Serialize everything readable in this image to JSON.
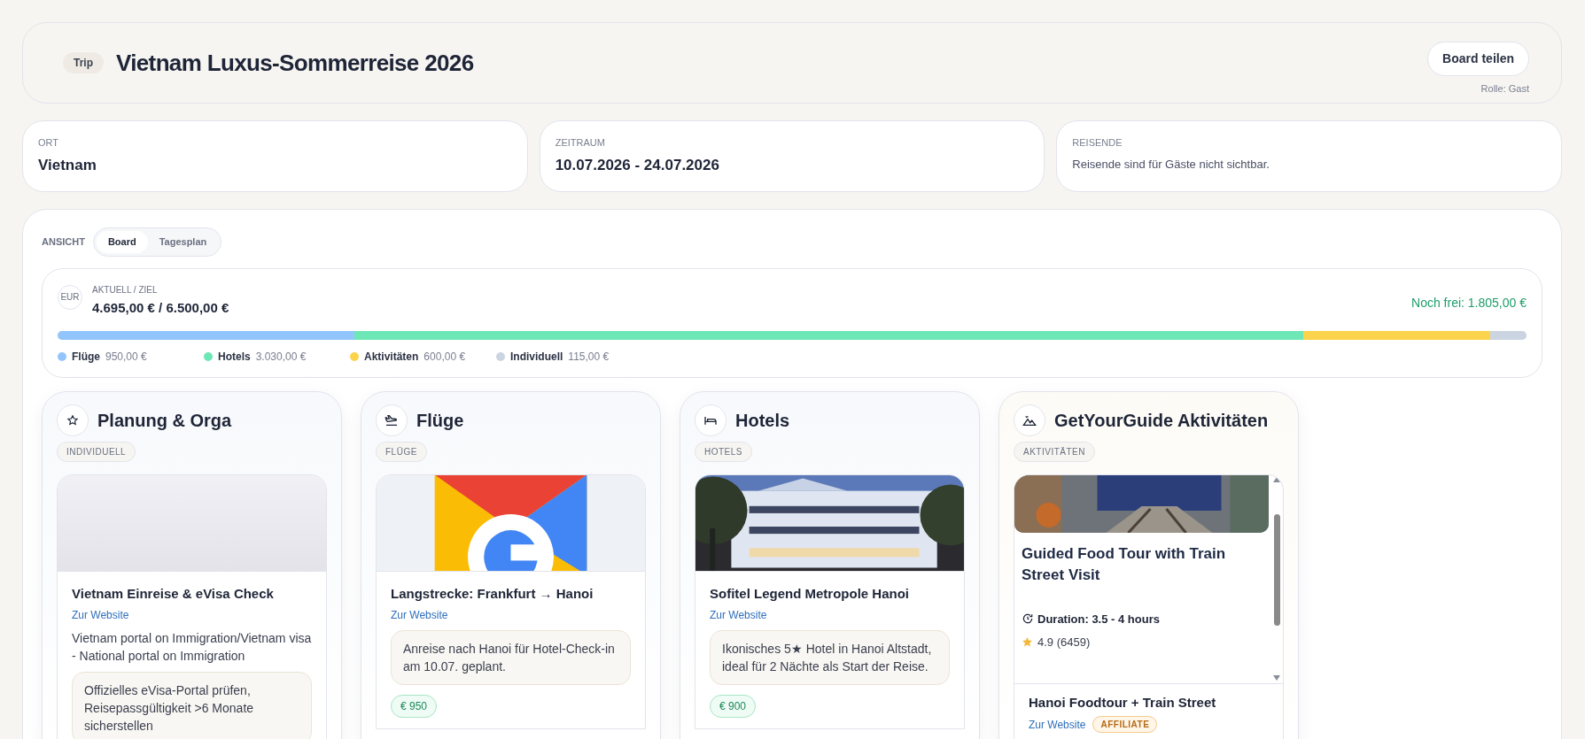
{
  "header": {
    "badge": "Trip",
    "title": "Vietnam Luxus-Sommerreise 2026",
    "share_button": "Board teilen",
    "role": "Rolle: Gast"
  },
  "info_cards": [
    {
      "label": "ORT",
      "value": "Vietnam",
      "kind": "value"
    },
    {
      "label": "ZEITRAUM",
      "value": "10.07.2026 - 24.07.2026",
      "kind": "value"
    },
    {
      "label": "REISENDE",
      "value": "Reisende sind für Gäste nicht sichtbar.",
      "kind": "note"
    }
  ],
  "view": {
    "label": "ANSICHT",
    "tabs": [
      {
        "label": "Board",
        "selected": true
      },
      {
        "label": "Tagesplan",
        "selected": false
      }
    ]
  },
  "budget": {
    "currency": "EUR",
    "caption": "AKTUELL / ZIEL",
    "amount": "4.695,00 € / 6.500,00 €",
    "remaining": "Noch frei: 1.805,00 €",
    "segments": [
      {
        "name": "Flüge",
        "value": "950,00 €",
        "color": "#93c5fd"
      },
      {
        "name": "Hotels",
        "value": "3.030,00 €",
        "color": "#6ee7b7"
      },
      {
        "name": "Aktivitäten",
        "value": "600,00 €",
        "color": "#fcd34d"
      },
      {
        "name": "Individuell",
        "value": "115,00 €",
        "color": "#cbd5e1"
      }
    ]
  },
  "columns": [
    {
      "title": "Planung & Orga",
      "tag": "INDIVIDUELL",
      "items": [
        {
          "kind": "link",
          "title": "Vietnam Einreise & eVisa Check",
          "link": "Zur Website",
          "description": "Vietnam portal on Immigration/Vietnam visa - National portal on Immigration",
          "note": "Offizielles eVisa-Portal prüfen, Reisepassgültigkeit >6 Monate sicherstellen"
        }
      ]
    },
    {
      "title": "Flüge",
      "tag": "FLÜGE",
      "items": [
        {
          "kind": "link",
          "title": "Langstrecke: Frankfurt → Hanoi",
          "link": "Zur Website",
          "note": "Anreise nach Hanoi für Hotel-Check-in am 10.07. geplant.",
          "price": "€ 950"
        }
      ]
    },
    {
      "title": "Hotels",
      "tag": "HOTELS",
      "items": [
        {
          "kind": "link",
          "title": "Sofitel Legend Metropole Hanoi",
          "link": "Zur Website",
          "note": "Ikonisches 5★ Hotel in Hanoi Altstadt, ideal für 2 Nächte als Start der Reise.",
          "price": "€ 900"
        }
      ]
    },
    {
      "title": "GetYourGuide Aktivitäten",
      "tag": "AKTIVITÄTEN",
      "items": [
        {
          "kind": "embed",
          "title": "Guided Food Tour with Train Street Visit",
          "duration": "Duration: 3.5 - 4 hours",
          "rating": "4.9 (6459)"
        },
        {
          "kind": "link",
          "title": "Hanoi Foodtour + Train Street",
          "link": "Zur Website",
          "badge": "AFFILIATE"
        }
      ]
    }
  ]
}
